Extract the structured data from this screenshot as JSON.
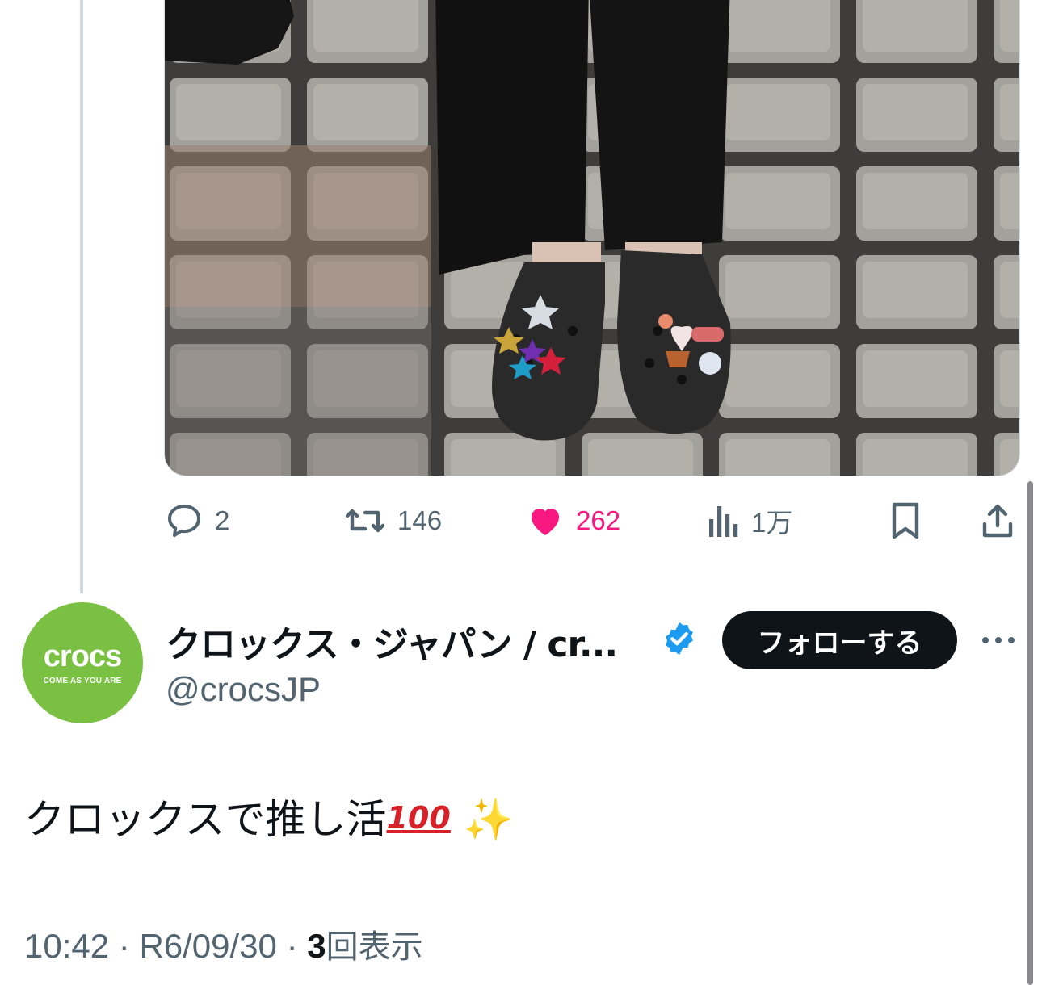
{
  "media": {
    "alt_icon": "photo-crocs-shoes-with-charms"
  },
  "actions": {
    "reply_count": "2",
    "retweet_count": "146",
    "like_count": "262",
    "views_count": "1万",
    "liked": true
  },
  "author": {
    "display_name": "クロックス・ジャパン / cr...",
    "handle": "@crocsJP",
    "avatar_word": "crocs",
    "avatar_tagline": "COME AS YOU ARE",
    "verified": true,
    "brand_color": "#7ac143"
  },
  "follow_label": "フォローする",
  "tweet": {
    "text": "クロックスで推し活",
    "emoji_100": "100",
    "emoji_sparkles": "✨"
  },
  "meta": {
    "time": "10:42",
    "sep": " · ",
    "date": "R6/09/30",
    "views_number": "3",
    "views_label": "回表示"
  },
  "colors": {
    "like": "#f91880",
    "muted": "#536471",
    "verified": "#1d9bf0",
    "text": "#0f1419"
  }
}
